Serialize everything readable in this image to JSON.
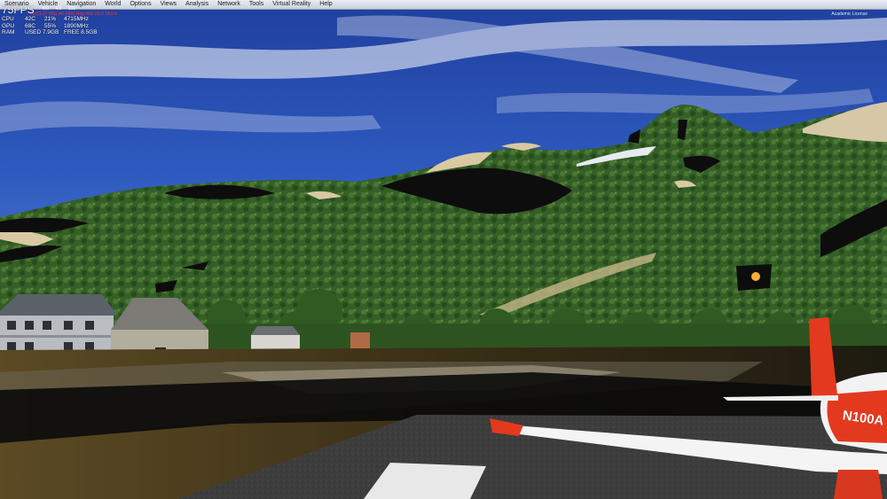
{
  "menubar": {
    "items": [
      "Scenario",
      "Vehicle",
      "Navigation",
      "World",
      "Options",
      "Views",
      "Analysis",
      "Network",
      "Tools",
      "Virtual Reality",
      "Help"
    ]
  },
  "overlay": {
    "fps": "75FPS",
    "top_numbers": "0.0 4.0 103",
    "red_line": "00:51:17  MSL  Alt:2491  Hdg:065  VS:0  TAS:0",
    "cpu": {
      "label": "CPU",
      "temp": "42C",
      "usage": "21%",
      "freq": "4715MHz"
    },
    "gpu": {
      "label": "GPU",
      "temp": "68C",
      "usage": "55%",
      "freq": "1890MHz"
    },
    "ram": {
      "label": "RAM",
      "used": "USED 7.9GB",
      "free": "FREE 8.5GB"
    }
  },
  "license": "Academic License",
  "aircraft": {
    "registration": "N100A",
    "color_body": "#ffffff",
    "color_accent": "#e3391e"
  },
  "colors": {
    "sky": "#2548a8",
    "foliage": "#3f6a2c",
    "tarmac": "#3a3a3a"
  }
}
